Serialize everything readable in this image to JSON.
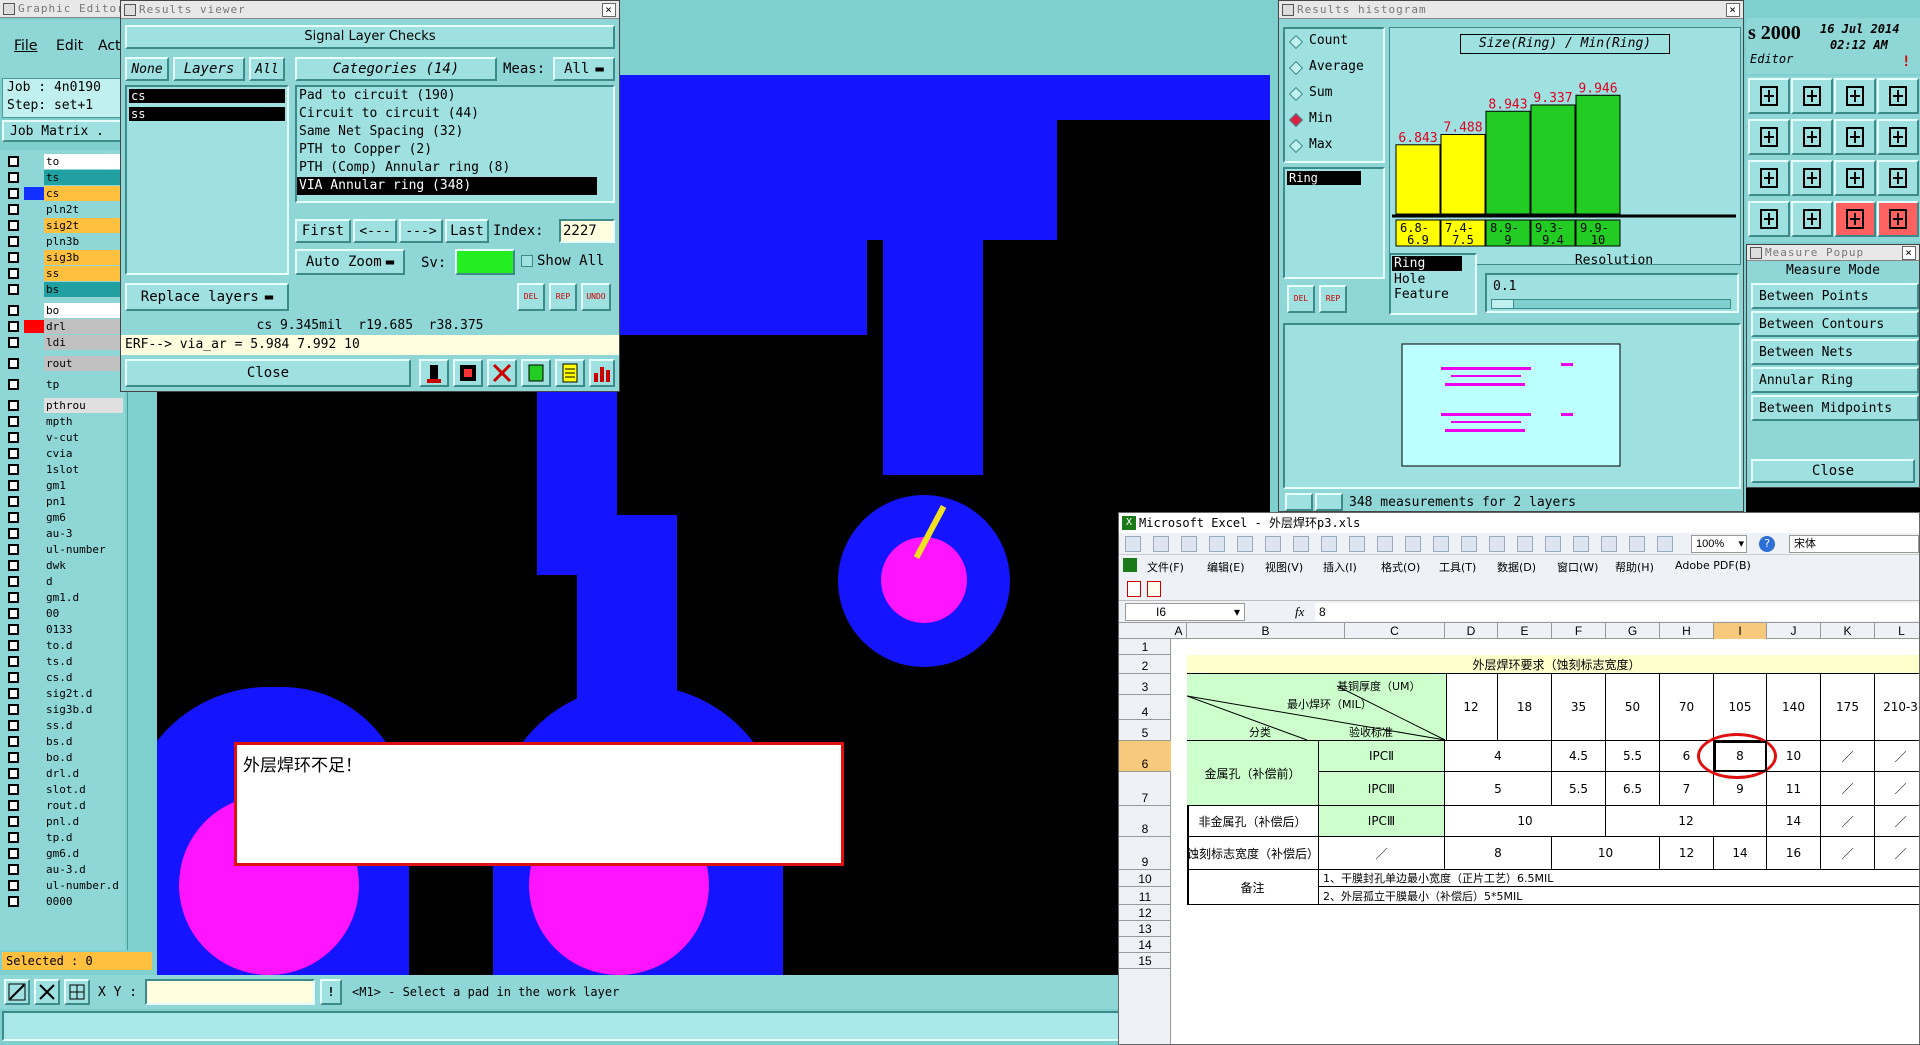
{
  "main_window": {
    "title": "Graphic Editor",
    "menu": [
      "File",
      "Edit",
      "Act"
    ],
    "job_label": "Job : 4n0190",
    "step_label": "Step: set+1",
    "job_matrix_label": "Job Matrix .",
    "selected_label": "Selected : 0",
    "xy_label": "X Y :",
    "status_message": "<M1> - Select a pad in the work layer",
    "layers": [
      {
        "name": "to",
        "color": "#ffffff",
        "swatch": ""
      },
      {
        "name": "ts",
        "color": "#20a0a0",
        "swatch": ""
      },
      {
        "name": "cs",
        "color": "#ffc040",
        "swatch": "#1030ff"
      },
      {
        "name": "pln2t",
        "color": "#8fd6d6",
        "swatch": ""
      },
      {
        "name": "sig2t",
        "color": "#ffc040",
        "swatch": ""
      },
      {
        "name": "pln3b",
        "color": "#8fd6d6",
        "swatch": ""
      },
      {
        "name": "sig3b",
        "color": "#ffc040",
        "swatch": ""
      },
      {
        "name": "ss",
        "color": "#ffc040",
        "swatch": ""
      },
      {
        "name": "bs",
        "color": "#20a0a0",
        "swatch": ""
      },
      {
        "name": "bo",
        "color": "#ffffff",
        "swatch": ""
      },
      {
        "name": "drl",
        "color": "#c0c0c0",
        "swatch": "#ff0000"
      },
      {
        "name": "ldi",
        "color": "#c0c0c0",
        "swatch": ""
      },
      {
        "name": "rout",
        "color": "#c0c0c0",
        "swatch": ""
      },
      {
        "name": "tp",
        "color": "#8fd6d6",
        "swatch": ""
      },
      {
        "name": "pthrou",
        "color": "#e0e0e0",
        "swatch": ""
      },
      {
        "name": "mpth",
        "color": "#8fd6d6",
        "swatch": ""
      },
      {
        "name": "v-cut",
        "color": "#8fd6d6",
        "swatch": ""
      },
      {
        "name": "cvia",
        "color": "#8fd6d6",
        "swatch": ""
      },
      {
        "name": "1slot",
        "color": "#8fd6d6",
        "swatch": ""
      },
      {
        "name": "gm1",
        "color": "#8fd6d6",
        "swatch": ""
      },
      {
        "name": "pn1",
        "color": "#8fd6d6",
        "swatch": ""
      },
      {
        "name": "gm6",
        "color": "#8fd6d6",
        "swatch": ""
      },
      {
        "name": "au-3",
        "color": "#8fd6d6",
        "swatch": ""
      },
      {
        "name": "ul-number",
        "color": "#8fd6d6",
        "swatch": ""
      },
      {
        "name": "dwk",
        "color": "#8fd6d6",
        "swatch": ""
      },
      {
        "name": "d",
        "color": "#8fd6d6",
        "swatch": ""
      },
      {
        "name": "gm1.d",
        "color": "#8fd6d6",
        "swatch": ""
      },
      {
        "name": "00",
        "color": "#8fd6d6",
        "swatch": ""
      },
      {
        "name": "0133",
        "color": "#8fd6d6",
        "swatch": ""
      },
      {
        "name": "to.d",
        "color": "#8fd6d6",
        "swatch": ""
      },
      {
        "name": "ts.d",
        "color": "#8fd6d6",
        "swatch": ""
      },
      {
        "name": "cs.d",
        "color": "#8fd6d6",
        "swatch": ""
      },
      {
        "name": "sig2t.d",
        "color": "#8fd6d6",
        "swatch": ""
      },
      {
        "name": "sig3b.d",
        "color": "#8fd6d6",
        "swatch": ""
      },
      {
        "name": "ss.d",
        "color": "#8fd6d6",
        "swatch": ""
      },
      {
        "name": "bs.d",
        "color": "#8fd6d6",
        "swatch": ""
      },
      {
        "name": "bo.d",
        "color": "#8fd6d6",
        "swatch": ""
      },
      {
        "name": "drl.d",
        "color": "#8fd6d6",
        "swatch": ""
      },
      {
        "name": "slot.d",
        "color": "#8fd6d6",
        "swatch": ""
      },
      {
        "name": "rout.d",
        "color": "#8fd6d6",
        "swatch": ""
      },
      {
        "name": "pnl.d",
        "color": "#8fd6d6",
        "swatch": ""
      },
      {
        "name": "tp.d",
        "color": "#8fd6d6",
        "swatch": ""
      },
      {
        "name": "gm6.d",
        "color": "#8fd6d6",
        "swatch": ""
      },
      {
        "name": "au-3.d",
        "color": "#8fd6d6",
        "swatch": ""
      },
      {
        "name": "ul-number.d",
        "color": "#8fd6d6",
        "swatch": ""
      },
      {
        "name": "0000",
        "color": "#8fd6d6",
        "swatch": ""
      }
    ],
    "layout_colors": {
      "copper": "#1414ff",
      "pad": "#ff14ff",
      "highlight": "#f0e020"
    }
  },
  "results_viewer": {
    "title": "Results viewer",
    "header": "Signal Layer Checks",
    "none_btn": "None",
    "layers_btn": "Layers",
    "all_btn": "All",
    "layers": [
      "cs",
      "ss"
    ],
    "categories_label": "Categories (14)",
    "meas_label": "Meas:",
    "meas_value": "All",
    "categories": [
      "Pad to circuit (190)",
      "Circuit to circuit (44)",
      "Same Net Spacing (32)",
      "PTH to Copper (2)",
      "PTH (Comp) Annular ring (8)",
      "VIA Annular ring (348)"
    ],
    "nav": {
      "first": "First",
      "prev": "<---",
      "next": "--->",
      "last": "Last",
      "index_label": "Index:",
      "index_value": "2227"
    },
    "auto_zoom": "Auto Zoom",
    "sv_label": "Sv:",
    "show_all": "Show All",
    "replace_layers": "Replace layers",
    "mini_btns": [
      "DEL",
      "REP",
      "UNDO"
    ],
    "info_line": "cs 9.345mil  r19.685  r38.375",
    "erf_line": "ERF--> via_ar = 5.984 7.992 10",
    "close": "Close"
  },
  "histogram": {
    "title": "Results histogram",
    "modes": [
      "Count",
      "Average",
      "Sum",
      "Min",
      "Max"
    ],
    "selected_mode": "Min",
    "list_item": "Ring",
    "chart_title": "Size(Ring) / Min(Ring)",
    "bin_labels_top": [
      "6.8-",
      "7.4-",
      "8.9-",
      "9.3-",
      "9.9-"
    ],
    "bin_labels_bottom": [
      "6.9",
      "7.5",
      "9",
      "9.4",
      "10"
    ],
    "bar_colors": [
      "#ffff00",
      "#ffff00",
      "#22cc22",
      "#22cc22",
      "#22cc22"
    ],
    "options": [
      "Ring",
      "Hole",
      "Feature"
    ],
    "resolution_label": "Resolution",
    "resolution_value": "0.1",
    "del_btns": [
      "DEL",
      "REP"
    ],
    "status_text": "348 measurements for 2 layers",
    "chart_data": {
      "type": "bar",
      "title": "Size(Ring) / Min(Ring)",
      "categories": [
        "6.8-6.9",
        "7.4-7.5",
        "8.9-9",
        "9.3-9.4",
        "9.9-10"
      ],
      "values": [
        6.843,
        7.488,
        8.943,
        9.337,
        9.946
      ],
      "ylim": [
        0,
        10
      ]
    }
  },
  "editor_panel": {
    "title_prefix": "s 2000",
    "date": "16 Jul 2014",
    "time": "02:12 AM",
    "editor_label": "Editor"
  },
  "measure_popup": {
    "title": "Measure Popup",
    "header": "Measure Mode",
    "modes": [
      "Between Points",
      "Between Contours",
      "Between Nets",
      "Annular Ring",
      "Between Midpoints"
    ],
    "selected": "Annular Ring",
    "close": "Close"
  },
  "message_box": {
    "text": "外层焊环不足！"
  },
  "excel": {
    "title": "Microsoft Excel - 外层焊环p3.xls",
    "zoom": "100%",
    "font": "宋体",
    "menu": [
      "文件(F)",
      "编辑(E)",
      "视图(V)",
      "插入(I)",
      "格式(O)",
      "工具(T)",
      "数据(D)",
      "窗口(W)",
      "帮助(H)",
      "Adobe PDF(B)"
    ],
    "name_box": "I6",
    "fx": "fx",
    "formula_value": "8",
    "columns": [
      "A",
      "B",
      "C",
      "D",
      "E",
      "F",
      "G",
      "H",
      "I",
      "J",
      "K",
      "L"
    ],
    "rows": [
      "1",
      "2",
      "3",
      "4",
      "5",
      "6",
      "7",
      "8",
      "9",
      "10",
      "11",
      "12",
      "13",
      "14",
      "15"
    ],
    "table": {
      "title": "外层焊环要求（蚀刻标志宽度）",
      "diag_top": "基铜厚度（UM）",
      "diag_mid": "最小焊环（MIL）",
      "diag_left": "分类",
      "diag_right": "验收标准",
      "thickness": [
        "12",
        "18",
        "35",
        "50",
        "70",
        "105",
        "140",
        "175",
        "210-3"
      ],
      "metal_hole": "金属孔（补偿前）",
      "ipc2": "IPCⅡ",
      "ipc3": "IPCⅢ",
      "row_ipc2": [
        "4",
        "4.5",
        "5.5",
        "6",
        "8",
        "10",
        "／",
        "／"
      ],
      "row_ipc3": [
        "5",
        "5.5",
        "6.5",
        "7",
        "9",
        "11",
        "／",
        "／"
      ],
      "nonmetal": "非金属孔（补偿后）",
      "nonmetal_vals": [
        "10",
        "12",
        "14",
        "／",
        "／"
      ],
      "etch": "蚀刻标志宽度（补偿后）",
      "etch_slash": "／",
      "etch_vals": [
        "8",
        "10",
        "12",
        "14",
        "16",
        "／",
        "／"
      ],
      "note_label": "备注",
      "note1": "1、干膜封孔单边最小宽度（正片工艺）6.5MIL",
      "note2": "2、外层孤立干膜最小（补偿后）5*5MIL"
    }
  }
}
